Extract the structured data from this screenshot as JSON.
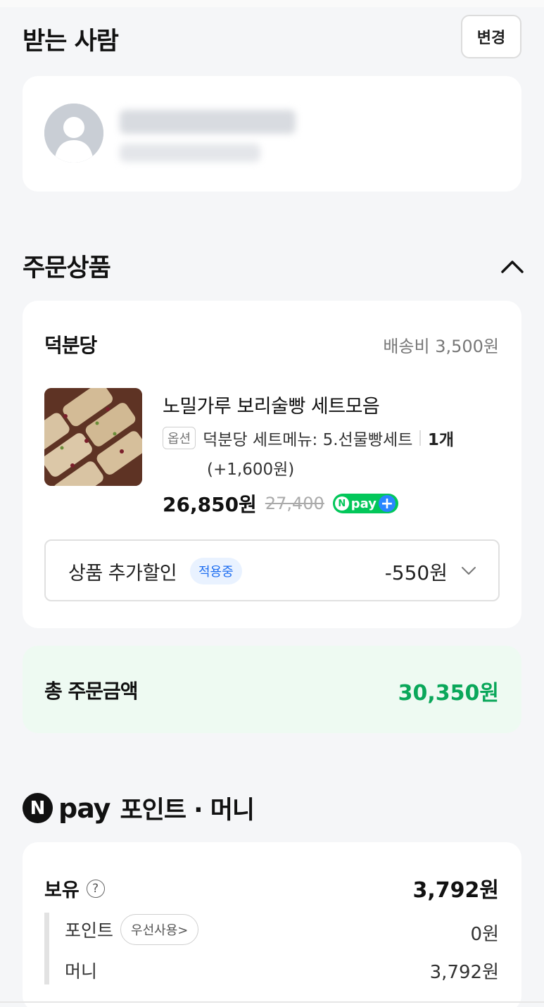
{
  "recipient": {
    "section_title": "받는 사람",
    "change_label": "변경"
  },
  "order": {
    "section_title": "주문상품",
    "seller": "덕분당",
    "shipping": "배송비 3,500원",
    "product_name": "노밀가루 보리술빵 세트모음",
    "option_tag": "옵션",
    "option_text": "덕분당 세트메뉴: 5.선물빵세트",
    "quantity": "1개",
    "option_price": "(+1,600원)",
    "price": "26,850원",
    "original_price": "27,400",
    "npay_badge": "pay",
    "discount_label": "상품 추가할인",
    "discount_badge": "적용중",
    "discount_amount": "-550원"
  },
  "total": {
    "label": "총 주문금액",
    "value": "30,350원"
  },
  "npay": {
    "logo_letter": "N",
    "word": "pay",
    "title_rest": "포인트 · 머니",
    "hold_label": "보유",
    "hold_value": "3,792원",
    "point_label": "포인트",
    "priority_label": "우선사용>",
    "point_value": "0원",
    "money_label": "머니",
    "money_value": "3,792원"
  },
  "colors": {
    "accent_green": "#0aa75a",
    "npay_green": "#03c75a",
    "badge_blue": "#1d6df0"
  }
}
